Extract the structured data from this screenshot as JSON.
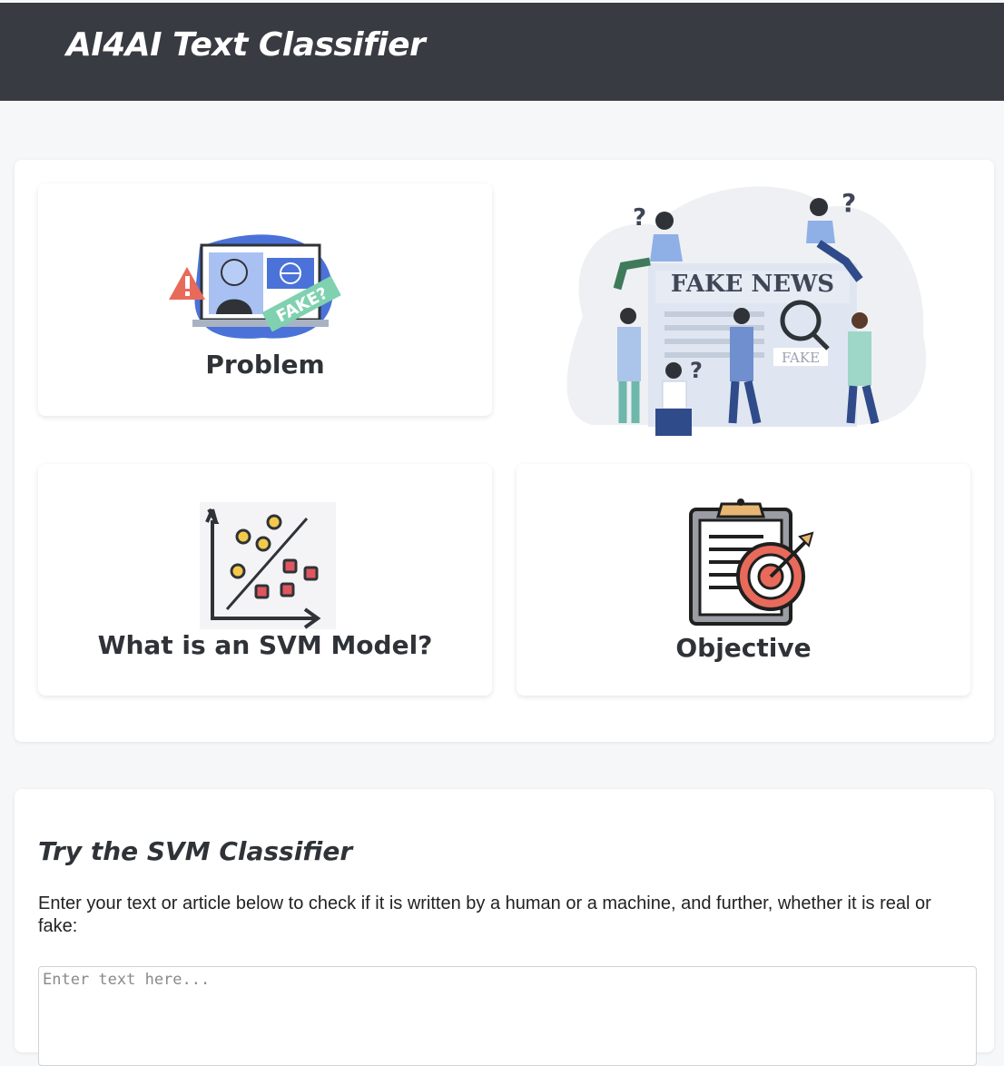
{
  "header": {
    "title": "AI4AI Text Classifier"
  },
  "cards": {
    "problem": {
      "label": "Problem",
      "badge": "FAKE?"
    },
    "svm": {
      "label": "What is an SVM Model?"
    },
    "objective": {
      "label": "Objective"
    }
  },
  "hero": {
    "headline": "FAKE NEWS",
    "stamp": "FAKE"
  },
  "classifier": {
    "title": "Try the SVM Classifier",
    "description": "Enter your text or article below to check if it is written by a human or a machine, and further, whether it is real or fake:",
    "placeholder": "Enter text here..."
  },
  "colors": {
    "header_bg": "#383b42",
    "page_bg": "#f5f7f9",
    "accent_blue": "#4a72d9",
    "accent_red": "#e86a5b",
    "accent_green": "#7fd1b0"
  }
}
